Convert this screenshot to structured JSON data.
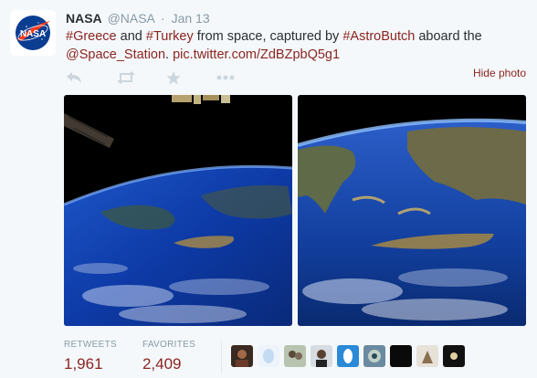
{
  "tweet": {
    "fullname": "NASA",
    "username": "@NASA",
    "separator": "·",
    "time": "Jan 13",
    "text": {
      "tag_greece": "#Greece",
      "and": " and ",
      "tag_turkey": "#Turkey",
      "middle": " from space, captured by ",
      "mention_butch": "#AstroButch",
      "aboard": " aboard the ",
      "mention_station": "@Space_Station",
      "space": ". ",
      "pic_link": "pic.twitter.com/ZdBZpbQ5g1"
    },
    "hide_photo": "Hide photo",
    "actions": [
      {
        "name": "reply",
        "icon": "reply-icon"
      },
      {
        "name": "retweet",
        "icon": "retweet-icon"
      },
      {
        "name": "favorite",
        "icon": "star-icon"
      },
      {
        "name": "more",
        "icon": "more-icon"
      }
    ],
    "stats": {
      "retweets_label": "RETWEETS",
      "retweets_value": "1,961",
      "favorites_label": "FAVORITES",
      "favorites_value": "2,409"
    },
    "favoriters_count_shown": 9
  },
  "colors": {
    "link": "#8b2520",
    "muted": "#8899a6",
    "text": "#292f33",
    "background": "#f5f8fa"
  }
}
